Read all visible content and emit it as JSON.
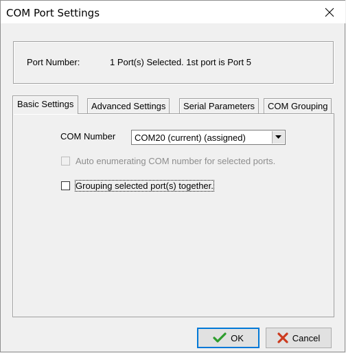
{
  "window": {
    "title": "COM Port Settings"
  },
  "port": {
    "label": "Port Number:",
    "value": "1 Port(s) Selected. 1st port is Port 5"
  },
  "tabs": [
    {
      "label": "Basic Settings",
      "active": true
    },
    {
      "label": "Advanced Settings",
      "active": false
    },
    {
      "label": "Serial Parameters",
      "active": false
    },
    {
      "label": "COM Grouping",
      "active": false
    }
  ],
  "basic": {
    "com_number_label": "COM Number",
    "com_number_value": "COM20 (current) (assigned)",
    "auto_enum_label": "Auto enumerating COM number for selected ports.",
    "auto_enum_checked": false,
    "auto_enum_enabled": false,
    "grouping_label": "Grouping selected port(s) together.",
    "grouping_checked": false
  },
  "buttons": {
    "ok": "OK",
    "cancel": "Cancel"
  },
  "colors": {
    "ok_icon": "#2e9d2e",
    "cancel_icon": "#cc3a1e"
  }
}
